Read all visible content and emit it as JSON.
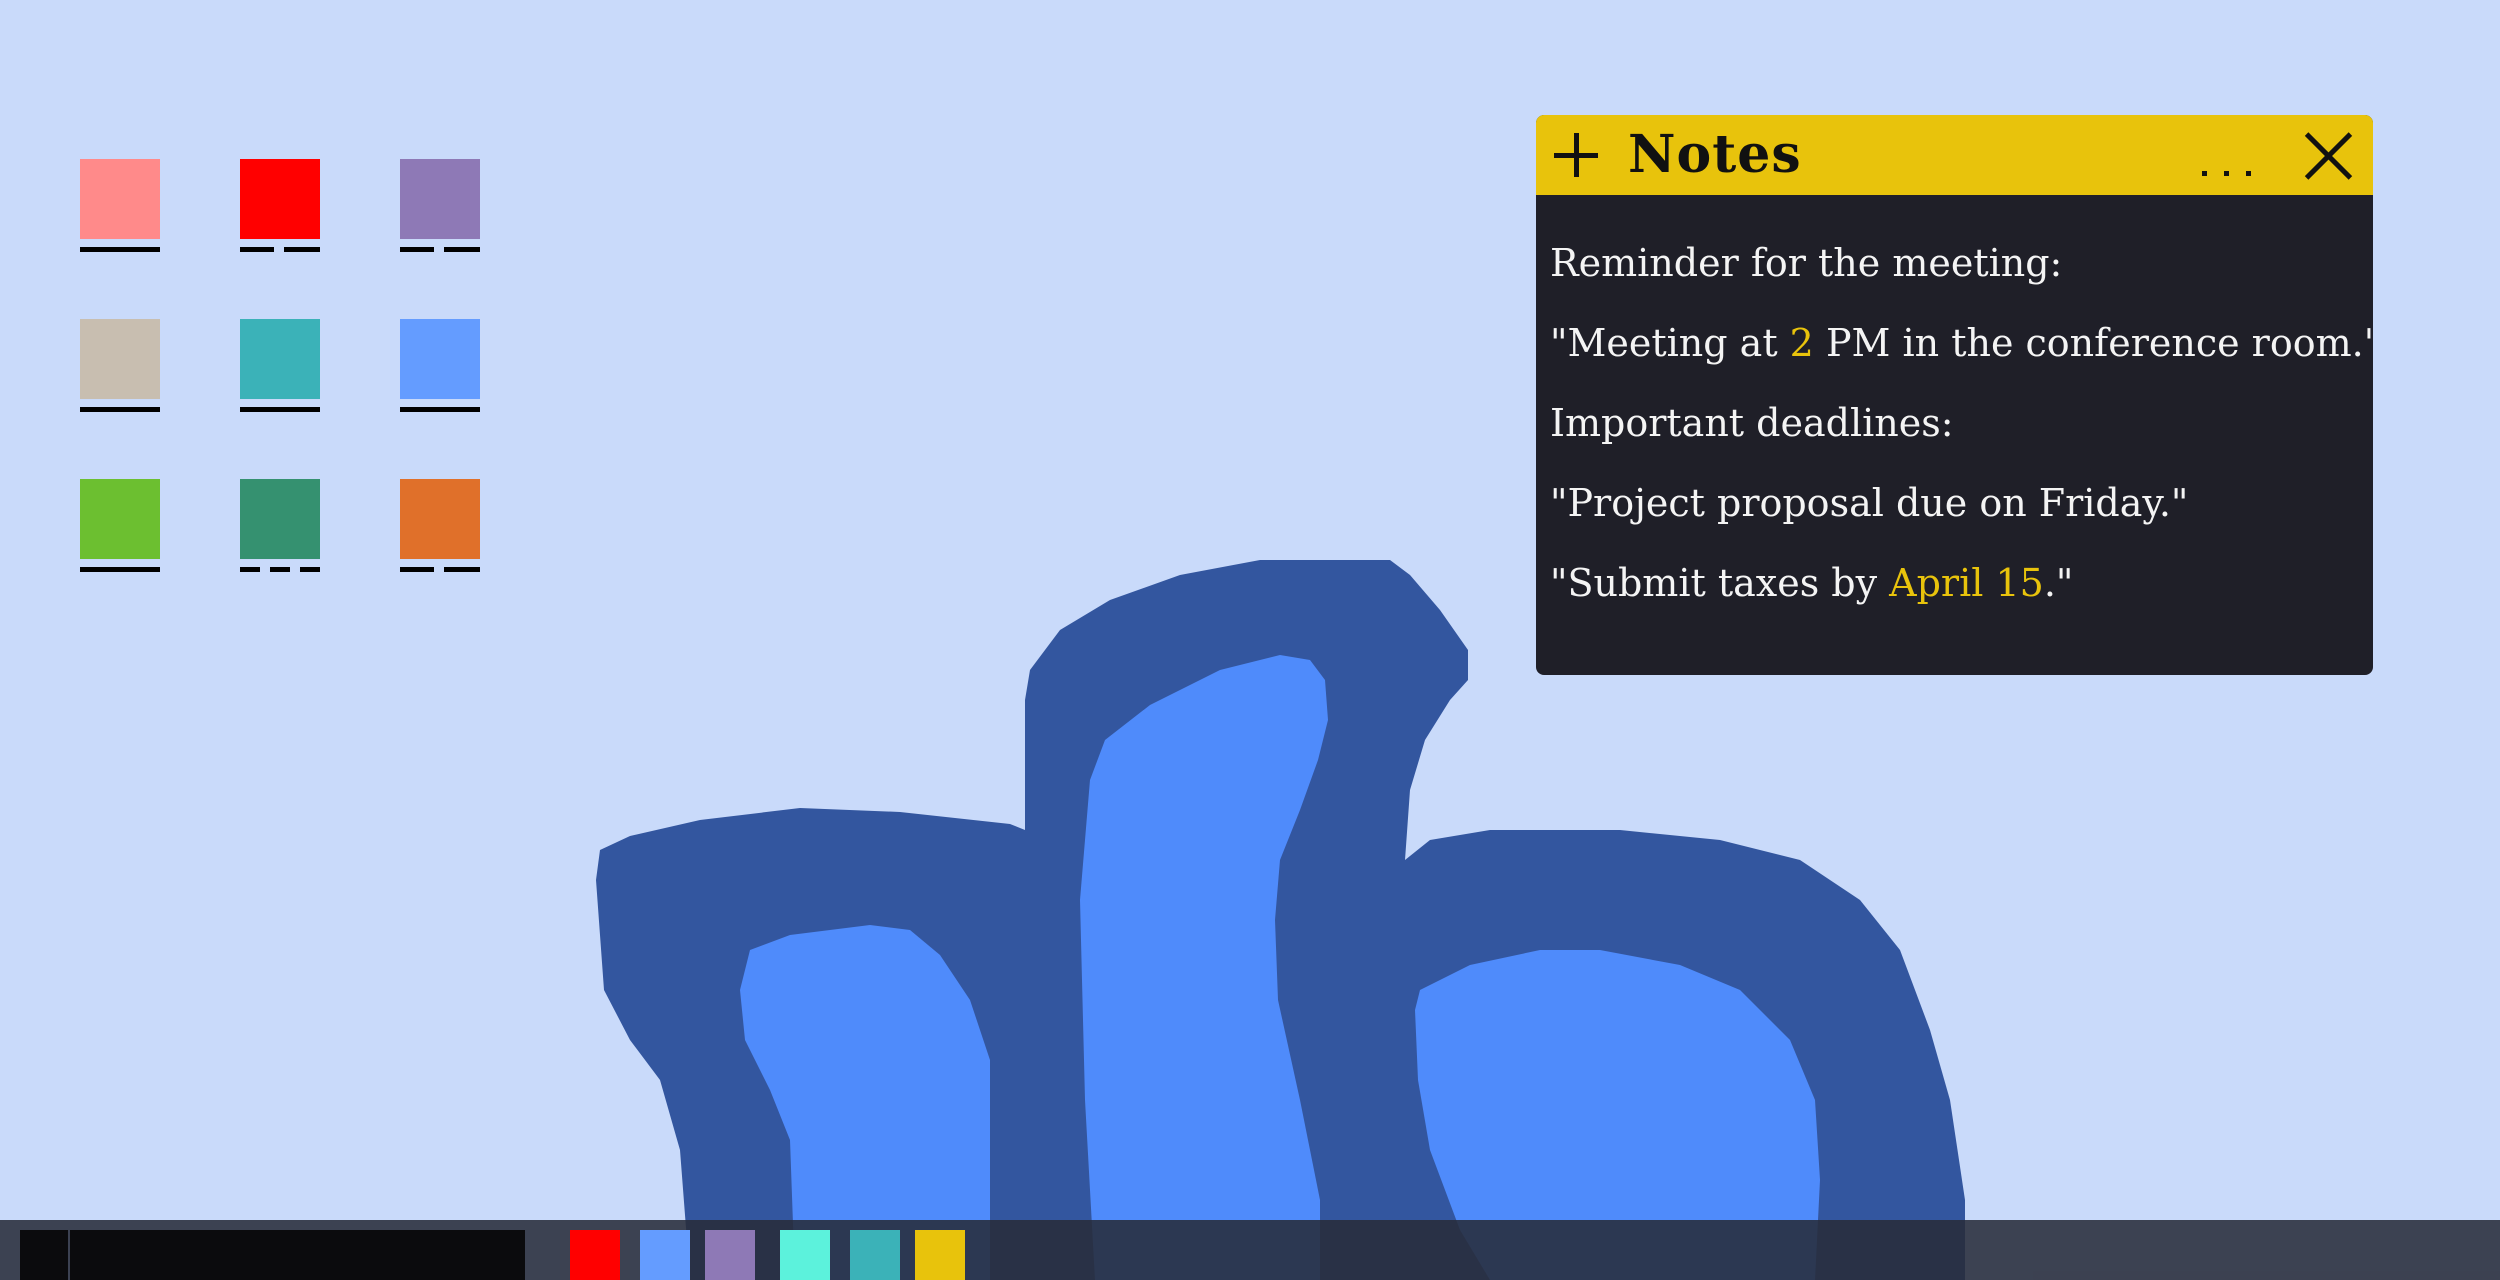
{
  "desktop": {
    "background_color": "#c9dafa",
    "icons": [
      {
        "name": "pink-folder-icon",
        "color": "#ff8a8a",
        "underline": "solid"
      },
      {
        "name": "red-folder-icon",
        "color": "#ff0000",
        "underline": "dash2"
      },
      {
        "name": "purple-folder-icon",
        "color": "#8e79b6",
        "underline": "dash2"
      },
      {
        "name": "beige-folder-icon",
        "color": "#c8beb0",
        "underline": "solid"
      },
      {
        "name": "teal-folder-icon",
        "color": "#3bb2b8",
        "underline": "solid"
      },
      {
        "name": "blue-folder-icon",
        "color": "#649cff",
        "underline": "solid"
      },
      {
        "name": "green-folder-icon",
        "color": "#6cbf30",
        "underline": "solid"
      },
      {
        "name": "dark-green-folder-icon",
        "color": "#359170",
        "underline": "dash3"
      },
      {
        "name": "orange-folder-icon",
        "color": "#e0702a",
        "underline": "dash2"
      }
    ],
    "wallpaper": {
      "outer_color": "#33569f",
      "inner_color": "#4f8bfb"
    }
  },
  "notes_window": {
    "title": "Notes",
    "titlebar_color": "#e8c30c",
    "body_color": "#1f1f28",
    "highlight_color": "#e8c30c",
    "lines": [
      {
        "parts": [
          {
            "text": "Reminder for the meeting:",
            "hl": false
          }
        ]
      },
      {
        "parts": [
          {
            "text": "\"Meeting at ",
            "hl": false
          },
          {
            "text": "2",
            "hl": true
          },
          {
            "text": " PM in the conference room.\"",
            "hl": false
          }
        ]
      },
      {
        "parts": [
          {
            "text": "Important deadlines:",
            "hl": false
          }
        ]
      },
      {
        "parts": [
          {
            "text": "\"Project proposal due on Friday.\"",
            "hl": false
          }
        ]
      },
      {
        "parts": [
          {
            "text": "\"Submit taxes by ",
            "hl": false
          },
          {
            "text": "April 15",
            "hl": true
          },
          {
            "text": ".\"",
            "hl": false
          }
        ]
      }
    ]
  },
  "taskbar": {
    "color": "#282c3a",
    "apps": [
      {
        "name": "red-app-icon",
        "color": "#ff0000"
      },
      {
        "name": "blue-app-icon",
        "color": "#649cff"
      },
      {
        "name": "purple-app-icon",
        "color": "#8e79b6"
      },
      {
        "name": "cyan-app-icon",
        "color": "#5cf2dc"
      },
      {
        "name": "teal-app-icon",
        "color": "#3bb2b8"
      },
      {
        "name": "yellow-app-icon",
        "color": "#e8c30c"
      }
    ]
  }
}
